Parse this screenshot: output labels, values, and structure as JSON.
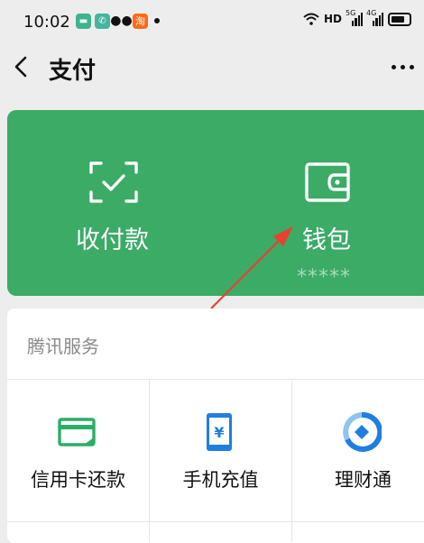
{
  "status_bar": {
    "time": "10:02",
    "network_label": "HD",
    "sig1_label": "5G",
    "sig2_label": "4G",
    "taobao_glyph": "淘"
  },
  "nav": {
    "title": "支付",
    "back_icon": "chevron-left-icon",
    "more_icon": "more-dots-icon"
  },
  "card": {
    "background": "#3bab66",
    "items": [
      {
        "label": "收付款",
        "icon": "scan-pay-icon"
      },
      {
        "label": "钱包",
        "icon": "wallet-icon",
        "masked_balance": "*****"
      }
    ]
  },
  "services": {
    "title": "腾讯服务",
    "items": [
      {
        "label": "信用卡还款",
        "icon": "credit-card-icon"
      },
      {
        "label": "手机充值",
        "icon": "phone-recharge-icon"
      },
      {
        "label": "理财通",
        "icon": "wealth-icon"
      }
    ]
  },
  "annotation": {
    "arrow_color": "#e8412f"
  }
}
